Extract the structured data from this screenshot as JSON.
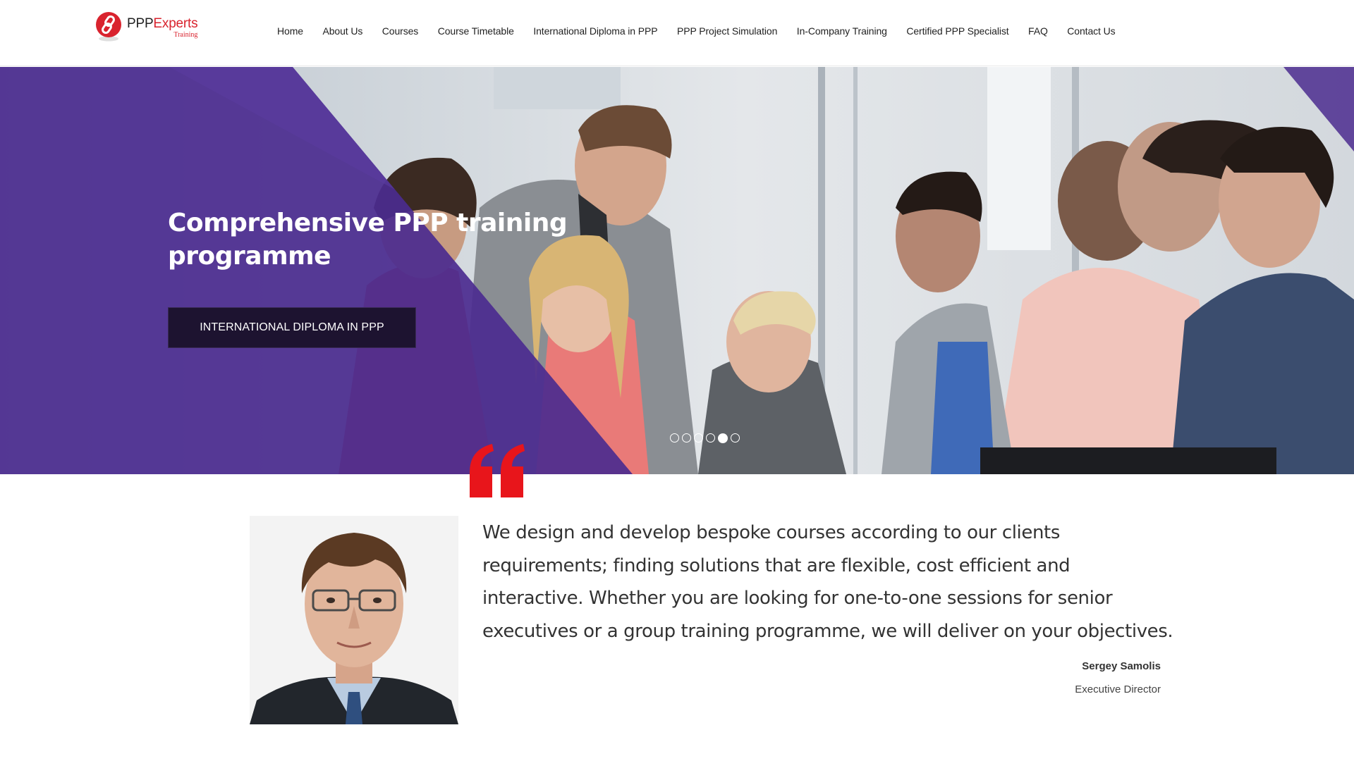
{
  "brand": {
    "name_part1": "PPP",
    "name_part2": "Experts",
    "subtitle": "Training",
    "colors": {
      "accent": "#d9232e",
      "hero_overlay": "#4b2b8f",
      "button_bg": "#1d1330"
    }
  },
  "nav": {
    "items": [
      {
        "label": "Home"
      },
      {
        "label": "About Us"
      },
      {
        "label": "Courses"
      },
      {
        "label": "Course Timetable"
      },
      {
        "label": "International Diploma in PPP"
      },
      {
        "label": "PPP Project Simulation"
      },
      {
        "label": "In-Company Training"
      },
      {
        "label": "Certified PPP Specialist"
      },
      {
        "label": "FAQ"
      },
      {
        "label": "Contact Us"
      }
    ]
  },
  "hero": {
    "title": "Comprehensive PPP training programme",
    "button_label": "INTERNATIONAL DIPLOMA IN PPP",
    "slides_total": 6,
    "active_slide": 5,
    "image_icon": "team-meeting-photo"
  },
  "testimonial": {
    "quote_icon": "quote-mark-icon",
    "quote": "We design and develop bespoke courses according to our clients requirements; finding solutions that are flexible, cost efficient and interactive. Whether you are looking for one-to-one sessions for senior executives or a group training programme, we will deliver on your objectives.",
    "author_name": "Sergey Samolis",
    "author_role": "Executive Director",
    "portrait_icon": "portrait-photo"
  }
}
